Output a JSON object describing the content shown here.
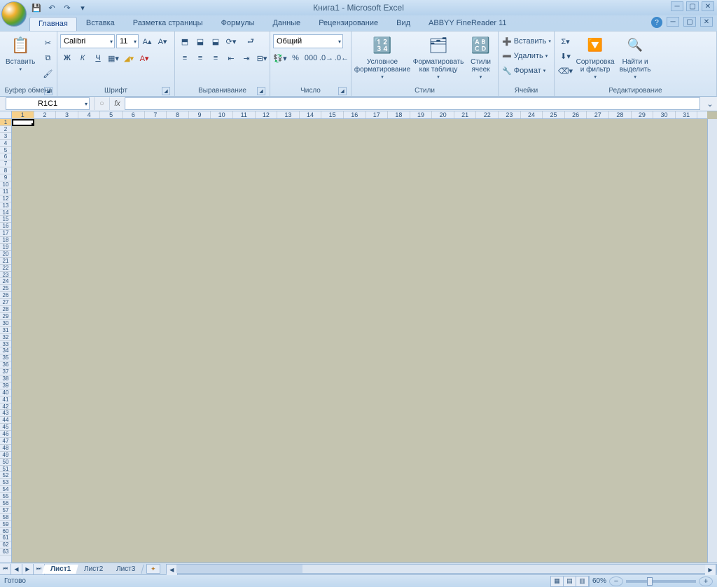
{
  "title": "Книга1 - Microsoft Excel",
  "qat": {
    "save": "💾",
    "undo": "↶",
    "redo": "↷"
  },
  "tabs": [
    "Главная",
    "Вставка",
    "Разметка страницы",
    "Формулы",
    "Данные",
    "Рецензирование",
    "Вид",
    "ABBYY FineReader 11"
  ],
  "active_tab": 0,
  "ribbon": {
    "clipboard": {
      "paste": "Вставить",
      "label": "Буфер обмена"
    },
    "font": {
      "name": "Calibri",
      "size": "11",
      "label": "Шрифт",
      "bold": "Ж",
      "italic": "К",
      "underline": "Ч"
    },
    "alignment": {
      "label": "Выравнивание"
    },
    "number": {
      "format": "Общий",
      "label": "Число"
    },
    "styles": {
      "cond": "Условное форматирование",
      "table": "Форматировать как таблицу",
      "cell": "Стили ячеек",
      "label": "Стили"
    },
    "cells": {
      "insert": "Вставить",
      "delete": "Удалить",
      "format": "Формат",
      "label": "Ячейки"
    },
    "editing": {
      "sort": "Сортировка и фильтр",
      "find": "Найти и выделить",
      "label": "Редактирование"
    }
  },
  "namebox": "R1C1",
  "columns": 31,
  "rows": 63,
  "sheets": [
    "Лист1",
    "Лист2",
    "Лист3"
  ],
  "active_sheet": 0,
  "status": "Готово",
  "zoom": "60%"
}
